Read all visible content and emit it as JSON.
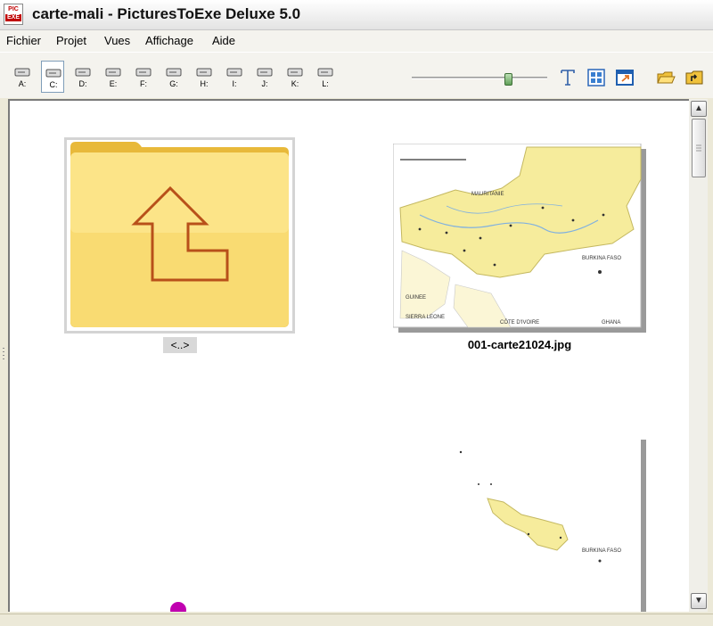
{
  "window": {
    "title": "carte-mali - PicturesToExe Deluxe 5.0",
    "icon_top": "PIC",
    "icon_bottom": "EXE"
  },
  "menu": [
    {
      "label": "Fichier"
    },
    {
      "label": "Projet"
    },
    {
      "label": "Vues"
    },
    {
      "label": "Affichage"
    },
    {
      "label": "Aide"
    }
  ],
  "drives": [
    {
      "label": "A:",
      "selected": false
    },
    {
      "label": "C:",
      "selected": true
    },
    {
      "label": "D:",
      "selected": false
    },
    {
      "label": "E:",
      "selected": false
    },
    {
      "label": "F:",
      "selected": false
    },
    {
      "label": "G:",
      "selected": false
    },
    {
      "label": "H:",
      "selected": false
    },
    {
      "label": "I:",
      "selected": false
    },
    {
      "label": "J:",
      "selected": false
    },
    {
      "label": "K:",
      "selected": false
    },
    {
      "label": "L:",
      "selected": false
    }
  ],
  "zoom": {
    "value": 0.73
  },
  "toolbar_icons": [
    "text-icon",
    "thumbnail-view-icon",
    "window-view-icon",
    "open-folder-icon",
    "parent-folder-icon"
  ],
  "browser": {
    "items": [
      {
        "label": "<..>",
        "kind": "parent-folder"
      },
      {
        "label": "001-carte21024.jpg",
        "kind": "image"
      },
      {
        "label": "",
        "kind": "image"
      }
    ]
  },
  "map": {
    "labels": [
      "MAURITANIE",
      "BURKINA FASO",
      "GUINEE",
      "SIERRA LEONE",
      "CÔTE D'IVOIRE",
      "GHANA"
    ],
    "inset_labels": [
      "BURKINA FASO"
    ]
  },
  "colors": {
    "folder": "#f7d768",
    "folder_dark": "#e8b93a",
    "arrow": "#b8501a",
    "map_land": "#f6ec9c",
    "marker": "#c000b0"
  }
}
